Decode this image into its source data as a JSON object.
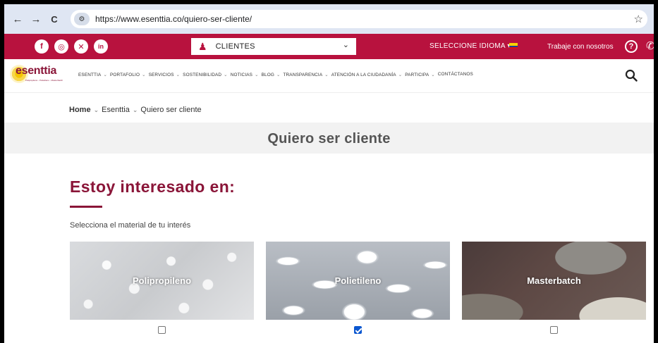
{
  "browser": {
    "url": "https://www.esenttia.co/quiero-ser-cliente/",
    "back_icon": "←",
    "forward_icon": "→",
    "reload_icon": "C",
    "star_icon": "☆"
  },
  "topbar": {
    "social": [
      {
        "name": "facebook-icon",
        "glyph": "f"
      },
      {
        "name": "instagram-icon",
        "glyph": "◎"
      },
      {
        "name": "x-icon",
        "glyph": "✕"
      },
      {
        "name": "linkedin-icon",
        "glyph": "in"
      }
    ],
    "clientes_label": "CLIENTES",
    "language_label": "SELECCIONE IDIOMA ▾",
    "trabaje_label": "Trabaje con nosotros",
    "help_glyph": "?",
    "phone_glyph": "✆",
    "colors": {
      "brand": "#b8123e",
      "heading": "#8a1538"
    }
  },
  "logo": {
    "word": "esenttia",
    "tagline": "Polipropileno - Polietileno - Masterbatch"
  },
  "menu": [
    "ESENTTIA",
    "PORTAFOLIO",
    "SERVICIOS",
    "SOSTENIBILIDAD",
    "NOTICIAS",
    "BLOG",
    "TRANSPARENCIA",
    "ATENCIÓN A LA CIUDADANÍA",
    "PARTICIPA",
    "CONTÁCTANOS"
  ],
  "breadcrumb": {
    "home": "Home",
    "level1": "Esenttia",
    "current": "Quiero ser cliente"
  },
  "page": {
    "title": "Quiero ser cliente",
    "heading": "Estoy interesado en:",
    "subtext": "Selecciona el material de tu interés"
  },
  "materials": [
    {
      "label": "Polipropileno",
      "checked": false
    },
    {
      "label": "Polietileno",
      "checked": true
    },
    {
      "label": "Masterbatch",
      "checked": false
    }
  ]
}
